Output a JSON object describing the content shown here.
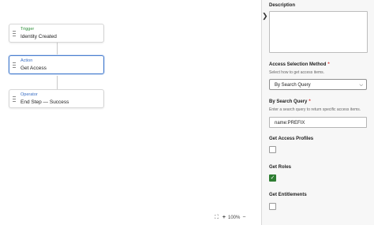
{
  "canvas": {
    "nodes": [
      {
        "type": "Trigger",
        "name": "Identity Created",
        "type_color": "#2f8f3a"
      },
      {
        "type": "Action",
        "name": "Get Access",
        "type_color": "#3a6fc4"
      },
      {
        "type": "Operator",
        "name": "End Step — Success",
        "type_color": "#3a6fc4"
      }
    ],
    "zoom": {
      "fit_icon": "fit-view-icon",
      "plus_icon": "zoom-in-icon",
      "level": "100%",
      "minus_icon": "zoom-out-icon"
    }
  },
  "panel": {
    "collapse_icon": "chevron-right-icon",
    "description": {
      "label": "Description",
      "value": ""
    },
    "access_method": {
      "label": "Access Selection Method",
      "required": "*",
      "help": "Select how to get access items.",
      "selected": "By Search Query"
    },
    "search_query": {
      "label": "By Search Query",
      "required": "*",
      "help": "Enter a search query to return specific access items.",
      "value": "name:PREFIX"
    },
    "get_access_profiles": {
      "label": "Get Access Profiles",
      "checked": false
    },
    "get_roles": {
      "label": "Get Roles",
      "checked": true,
      "check_glyph": "✓"
    },
    "get_entitlements": {
      "label": "Get Entitlements",
      "checked": false
    }
  },
  "colors": {
    "accent": "#4a7fd0",
    "check_green": "#2e7d32",
    "required_red": "#d93636"
  }
}
